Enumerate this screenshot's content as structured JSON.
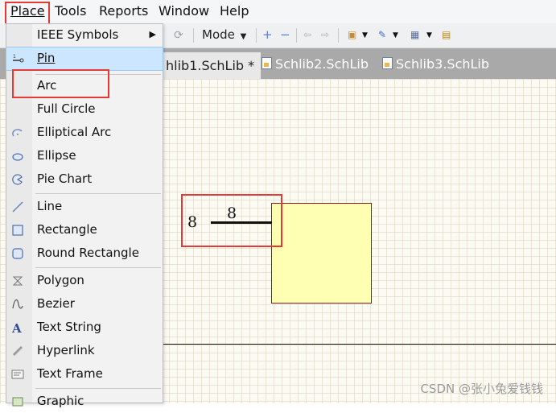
{
  "menu_bar": {
    "place": "Place",
    "tools": "Tools",
    "reports": "Reports",
    "window": "Window",
    "help": "Help"
  },
  "toolbar": {
    "mode_label": "Mode"
  },
  "tabs": [
    {
      "label": "hlib1.SchLib *",
      "active": true
    },
    {
      "label": "Schlib2.SchLib",
      "active": false
    },
    {
      "label": "Schlib3.SchLib",
      "active": false
    }
  ],
  "place_menu": {
    "items": [
      {
        "label": "IEEE Symbols",
        "has_submenu": true,
        "icon": "none"
      },
      {
        "label": "Pin",
        "selected": true,
        "icon": "pin-icon"
      },
      {
        "label": "Arc",
        "icon": "none"
      },
      {
        "label": "Full Circle",
        "icon": "none"
      },
      {
        "label": "Elliptical Arc",
        "icon": "elliptical-arc-icon"
      },
      {
        "label": "Ellipse",
        "icon": "ellipse-icon"
      },
      {
        "label": "Pie Chart",
        "icon": "pie-chart-icon"
      },
      {
        "label": "Line",
        "icon": "line-icon"
      },
      {
        "label": "Rectangle",
        "icon": "rectangle-icon"
      },
      {
        "label": "Round Rectangle",
        "icon": "round-rectangle-icon"
      },
      {
        "label": "Polygon",
        "icon": "polygon-icon"
      },
      {
        "label": "Bezier",
        "icon": "bezier-icon"
      },
      {
        "label": "Text String",
        "icon": "text-string-icon"
      },
      {
        "label": "Hyperlink",
        "icon": "hyperlink-icon"
      },
      {
        "label": "Text Frame",
        "icon": "text-frame-icon"
      },
      {
        "label": "Graphic",
        "icon": "graphic-icon"
      }
    ]
  },
  "canvas": {
    "pin_designator": "8",
    "pin_name": "8"
  },
  "watermark": "CSDN @张小兔爱钱钱",
  "colors": {
    "highlight_red": "#e53935",
    "selection_blue": "#cce6ff",
    "component_body": "#ffffb3",
    "component_border": "#8b1a1a"
  }
}
